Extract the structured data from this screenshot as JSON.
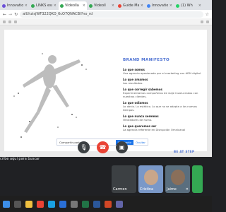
{
  "tabs": [
    {
      "label": "Innovation",
      "color": "#6b4fd8",
      "active": false
    },
    {
      "label": "LINKS escol",
      "color": "#34a853",
      "active": false
    },
    {
      "label": "Videolla",
      "color": "#34a853",
      "active": true
    },
    {
      "label": "Videoll",
      "color": "#34a853",
      "active": false
    },
    {
      "label": "Guide Mana",
      "color": "#ea4335",
      "active": false
    },
    {
      "label": "Innovation",
      "color": "#4285f4",
      "active": false
    },
    {
      "label": "(1) Wh",
      "color": "#25d366",
      "active": false
    }
  ],
  "address": {
    "url": "alUhzisjWF322QKO_6cO7QNACBI?no_rd"
  },
  "pdf": {
    "manifesto_title": "BRAND MANIFESTO",
    "items": [
      {
        "h": "Lo que somos",
        "t": "Una agencia apasionada por el marketing con ADN digital."
      },
      {
        "h": "Lo que amamos",
        "t": "Los resultados."
      },
      {
        "h": "Lo que corregir sabemos",
        "t": "Experimentamos compañeros de viaje involucrados con nuestros clientes."
      },
      {
        "h": "Lo que odiamos",
        "t": "Lo obvio. Lo estático. Lo que no se adapta a los nuevos tiempos."
      },
      {
        "h": "Lo que nunca seremos",
        "t": "Vendedores de humo."
      },
      {
        "h": "Lo que queremos ser",
        "t": "La agencia referente en Disrupción Omnicanal"
      }
    ],
    "page_label": "BE AT STEP"
  },
  "notice": {
    "text": "Compartir pantalla",
    "primary": "Compartir",
    "secondary": "Ocultar"
  },
  "meet": {
    "chat_hint": "cribe aquí para buscar",
    "participants": [
      {
        "name": "Carmen"
      },
      {
        "name": "Cristina"
      },
      {
        "name": "Jaime"
      }
    ]
  },
  "taskbar": {
    "time": ""
  }
}
